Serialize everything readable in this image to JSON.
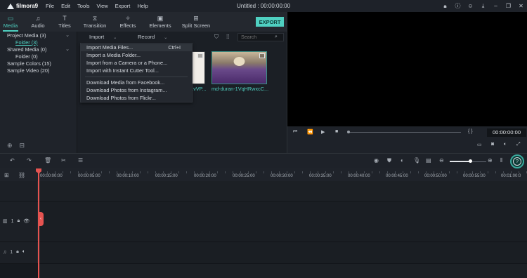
{
  "app": {
    "logo_text": "filmora9",
    "menu": [
      "File",
      "Edit",
      "Tools",
      "View",
      "Export",
      "Help"
    ],
    "document_title": "Untitled : 00:00:00:00"
  },
  "window_icons": [
    "lock-icon",
    "info-icon",
    "user-icon",
    "download-icon",
    "minimize-icon",
    "maximize-icon",
    "close-icon"
  ],
  "toolbar": {
    "tabs": [
      {
        "label": "Media",
        "icon": "folder-icon",
        "active": true
      },
      {
        "label": "Audio",
        "icon": "music-note-icon",
        "active": false
      },
      {
        "label": "Titles",
        "icon": "text-icon",
        "active": false
      },
      {
        "label": "Transition",
        "icon": "transition-icon",
        "active": false
      },
      {
        "label": "Effects",
        "icon": "effects-icon",
        "active": false
      },
      {
        "label": "Elements",
        "icon": "image-icon",
        "active": false
      },
      {
        "label": "Split Screen",
        "icon": "split-screen-icon",
        "active": false
      }
    ],
    "export_label": "EXPORT"
  },
  "library": {
    "items": [
      {
        "label": "Project Media (3)",
        "expanded": true
      },
      {
        "label": "Folder (3)",
        "selected": true
      },
      {
        "label": "Shared Media (0)",
        "expanded": true
      },
      {
        "label": "Folder (0)"
      },
      {
        "label": "Sample Colors (15)"
      },
      {
        "label": "Sample Video (20)"
      }
    ]
  },
  "media_bar": {
    "import_label": "Import",
    "record_label": "Record",
    "search_placeholder": "Search"
  },
  "media_items": [
    {
      "name": "...vVP..."
    },
    {
      "name": "md-duran-1VqHRwxcC..."
    }
  ],
  "import_menu": {
    "items": [
      {
        "label": "Import Media Files...",
        "shortcut": "Ctrl+I",
        "highlighted": true
      },
      {
        "label": "Import a Media Folder..."
      },
      {
        "label": "Import from a Camera or a Phone..."
      },
      {
        "label": "Import with Instant Cutter Tool..."
      },
      {
        "label": "Download Media from Facebook..."
      },
      {
        "label": "Download Photos from Instagram..."
      },
      {
        "label": "Download Photos from Flickr..."
      }
    ]
  },
  "preview": {
    "timecode": "00:00:00:00",
    "brackets": "{    }"
  },
  "ruler": {
    "labels": [
      "00:00:00:00",
      "00:00:05:00",
      "00:00:10:00",
      "00:00:15:00",
      "00:00:20:00",
      "00:00:25:00",
      "00:00:30:00",
      "00:00:35:00",
      "00:00:40:00",
      "00:00:45:00",
      "00:00:50:00",
      "00:00:55:00",
      "00:01:00:0"
    ]
  },
  "tracks": {
    "video_label": "1",
    "audio_label": "1"
  },
  "colors": {
    "accent": "#4fd0c1",
    "playhead": "#e55350",
    "preview_bg": "#000000"
  }
}
